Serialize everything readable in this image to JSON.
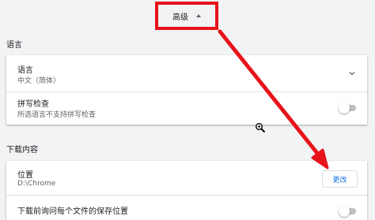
{
  "advanced": {
    "label": "高级",
    "toggle_icon": "triangle-up-icon"
  },
  "language_section": {
    "title": "语言",
    "language_row": {
      "title": "语言",
      "value": "中文（简体）",
      "icon": "chevron-down-icon"
    },
    "spellcheck_row": {
      "title": "拼写检查",
      "subtitle": "所选语言不支持拼写检查",
      "enabled": false
    }
  },
  "downloads_section": {
    "title": "下载内容",
    "location_row": {
      "title": "位置",
      "value": "D:\\Chrome",
      "button_label": "更改"
    },
    "ask_row": {
      "title": "下载前询问每个文件的保存位置",
      "enabled": false
    }
  },
  "colors": {
    "annotation_red": "#e8131a",
    "link_blue": "#1a73e8"
  }
}
